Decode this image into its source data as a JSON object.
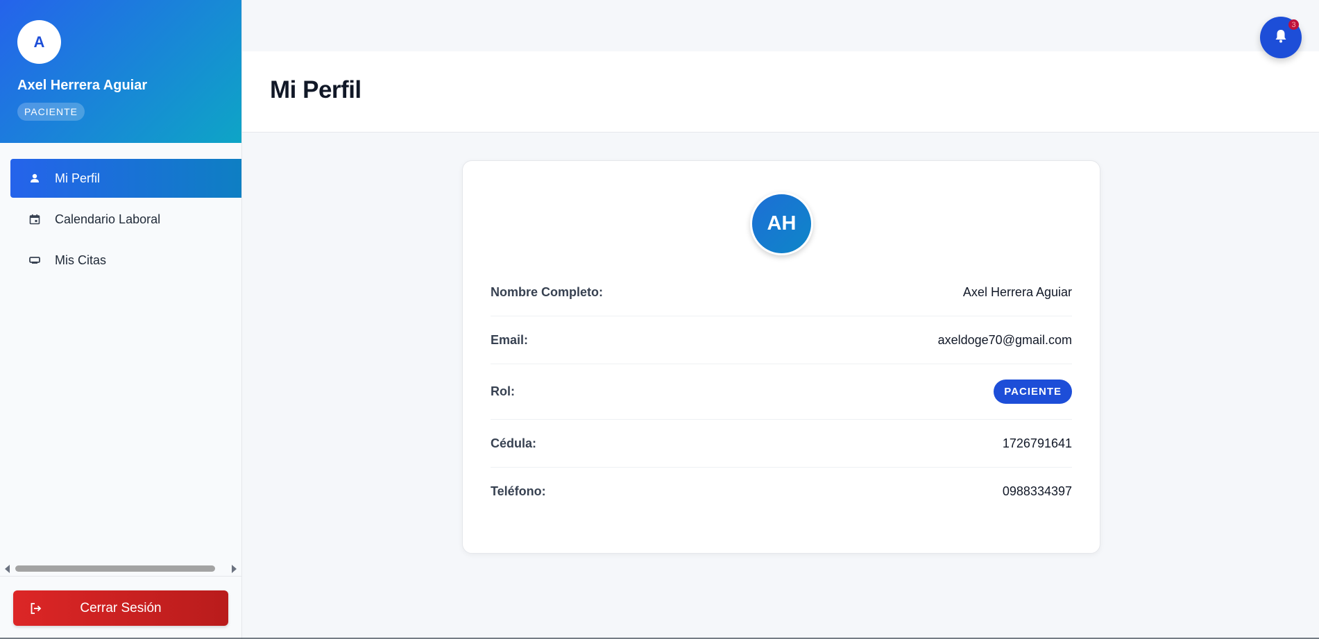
{
  "sidebar": {
    "avatar_initial": "A",
    "user_name": "Axel Herrera Aguiar",
    "role": "PACIENTE",
    "items": [
      {
        "label": "Mi Perfil",
        "icon": "person-icon",
        "active": true
      },
      {
        "label": "Calendario Laboral",
        "icon": "calendar-icon",
        "active": false
      },
      {
        "label": "Mis Citas",
        "icon": "appointment-icon",
        "active": false
      }
    ],
    "logout_label": "Cerrar Sesión"
  },
  "header": {
    "title": "Mi Perfil",
    "notification_count": "3"
  },
  "profile": {
    "initials": "AH",
    "fields": [
      {
        "label": "Nombre Completo:",
        "value": "Axel Herrera Aguiar"
      },
      {
        "label": "Email:",
        "value": "axeldoge70@gmail.com"
      },
      {
        "label": "Rol:",
        "value": "PACIENTE"
      },
      {
        "label": "Cédula:",
        "value": "1726791641"
      },
      {
        "label": "Teléfono:",
        "value": "0988334397"
      }
    ]
  },
  "colors": {
    "primary": "#2563eb",
    "accent": "#0ea5c6",
    "danger": "#dc2626"
  }
}
